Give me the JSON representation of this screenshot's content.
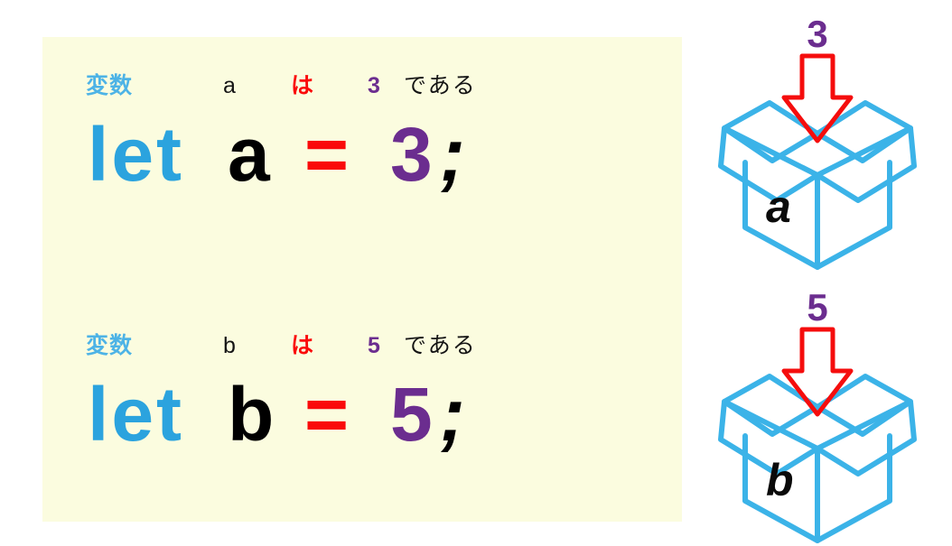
{
  "colors": {
    "panel_background": "#FBFCDF",
    "page_background": "#FFFFFF",
    "keyword_blue": "#2BA3DE",
    "annotation_blue": "#4DB3E6",
    "box_blue": "#3BB3E8",
    "value_purple": "#6B2D8F",
    "operator_red": "#FA0A0A",
    "arrow_red": "#F50D0D",
    "text_black": "#000000"
  },
  "statements": [
    {
      "annotation": {
        "keyword_label": "変数",
        "variable_name": "a",
        "particle": "は",
        "value": "3",
        "copula": "である"
      },
      "code": {
        "keyword": "let",
        "variable": "a",
        "operator": "=",
        "value": "3",
        "terminator": ";"
      }
    },
    {
      "annotation": {
        "keyword_label": "変数",
        "variable_name": "b",
        "particle": "は",
        "value": "5",
        "copula": "である"
      },
      "code": {
        "keyword": "let",
        "variable": "b",
        "operator": "=",
        "value": "5",
        "terminator": ";"
      }
    }
  ],
  "boxes": [
    {
      "value": "3",
      "label": "a"
    },
    {
      "value": "5",
      "label": "b"
    }
  ]
}
